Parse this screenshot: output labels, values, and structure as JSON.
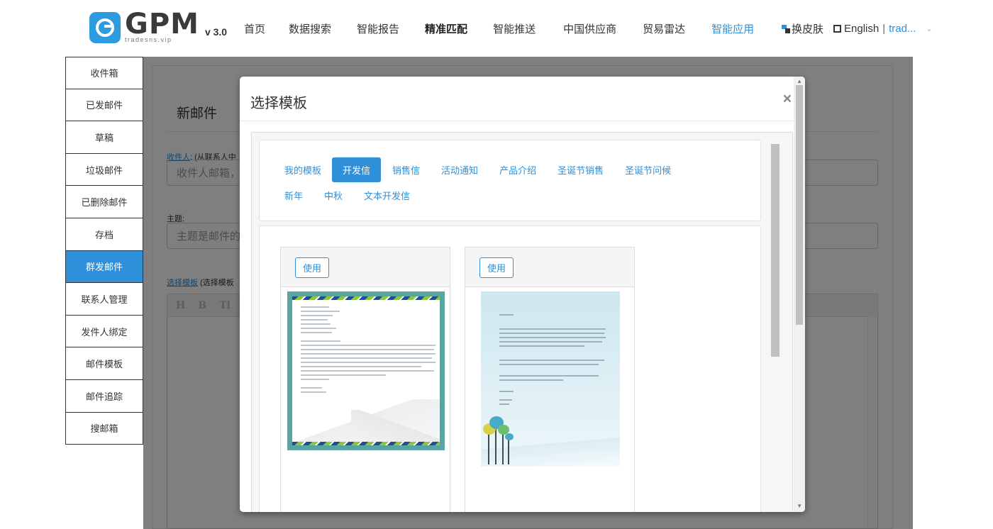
{
  "header": {
    "logo_main": "GPM",
    "logo_sub": "tradesns.vip",
    "version": "v 3.0",
    "nav": [
      {
        "label": "首页",
        "style": "normal"
      },
      {
        "label": "数据搜索",
        "style": "normal"
      },
      {
        "label": "智能报告",
        "style": "normal"
      },
      {
        "label": "精准匹配",
        "style": "bold"
      },
      {
        "label": "智能推送",
        "style": "normal"
      },
      {
        "label": "中国供应商",
        "style": "normal"
      },
      {
        "label": "贸易雷达",
        "style": "normal"
      },
      {
        "label": "智能应用",
        "style": "active"
      }
    ],
    "skin_label": "换皮肤",
    "language_label": "English",
    "separator": "|",
    "user_label": "trad...",
    "icons": {
      "skin": "skin-icon",
      "language": "flag-icon",
      "dropdown": "chevron-down-icon"
    }
  },
  "sidebar": {
    "items": [
      {
        "label": "收件箱",
        "active": false
      },
      {
        "label": "已发邮件",
        "active": false
      },
      {
        "label": "草稿",
        "active": false
      },
      {
        "label": "垃圾邮件",
        "active": false
      },
      {
        "label": "已删除邮件",
        "active": false
      },
      {
        "label": "存档",
        "active": false
      },
      {
        "label": "群发邮件",
        "active": true
      },
      {
        "label": "联系人管理",
        "active": false
      },
      {
        "label": "发件人绑定",
        "active": false
      },
      {
        "label": "邮件模板",
        "active": false
      },
      {
        "label": "邮件追踪",
        "active": false
      },
      {
        "label": "搜邮箱",
        "active": false
      }
    ]
  },
  "compose": {
    "title": "新邮件",
    "recipient_link": "收件人",
    "recipient_hint": ": (从联系人中",
    "recipient_placeholder": "收件人邮箱，",
    "subject_label": "主题:",
    "subject_placeholder": "主题是邮件的",
    "template_link": "选择模板",
    "template_hint": " (选择模板",
    "editor_buttons": [
      "H",
      "B",
      "Tl"
    ]
  },
  "modal": {
    "title": "选择模板",
    "close": "×",
    "tabs_row1": [
      "我的模板",
      "开发信",
      "销售信",
      "活动通知",
      "产品介绍",
      "圣诞节销售",
      "圣诞节问候"
    ],
    "tabs_row2": [
      "新年",
      "中秋",
      "文本开发信"
    ],
    "active_tab": "开发信",
    "templates": [
      {
        "use_label": "使用",
        "style": "letter-border"
      },
      {
        "use_label": "使用",
        "style": "winter-landscape"
      }
    ]
  },
  "colors": {
    "accent": "#2f8fd8",
    "sidebar_active": "#2f8fd8",
    "overlay": "rgba(0,0,0,0.5)"
  }
}
